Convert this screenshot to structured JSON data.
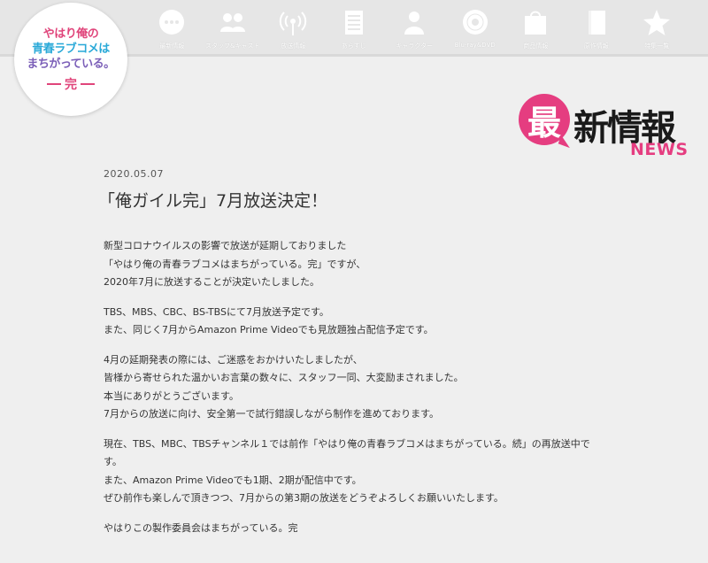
{
  "logo": {
    "lines": [
      "やはり俺の",
      "青春ラブコメは",
      "まちがっている。"
    ],
    "suffix": "完"
  },
  "nav": {
    "items": [
      {
        "label": "最新情報",
        "icon": "speech-bubble-icon"
      },
      {
        "label": "スタッフ&キャスト",
        "icon": "people-icon"
      },
      {
        "label": "放送情報",
        "icon": "broadcast-icon"
      },
      {
        "label": "あらすじ",
        "icon": "document-icon"
      },
      {
        "label": "キャラクター",
        "icon": "person-icon"
      },
      {
        "label": "Blu-ray&DVD",
        "icon": "disc-icon"
      },
      {
        "label": "商品情報",
        "icon": "shopping-bag-icon"
      },
      {
        "label": "原作情報",
        "icon": "book-icon"
      },
      {
        "label": "特集一覧",
        "icon": "star-icon"
      }
    ]
  },
  "heading": {
    "badge": "最",
    "title": "新情報",
    "sub": "NEWS"
  },
  "article": {
    "date": "2020.05.07",
    "title": "「俺ガイル完」7月放送決定！",
    "paragraphs": [
      [
        "新型コロナウイルスの影響で放送が延期しておりました",
        "「やはり俺の青春ラブコメはまちがっている。完」ですが、",
        "2020年7月に放送することが決定いたしました。"
      ],
      [
        "TBS、MBS、CBC、BS-TBSにて7月放送予定です。",
        "また、同じく7月からAmazon Prime Videoでも見放題独占配信予定です。"
      ],
      [
        "4月の延期発表の際には、ご迷惑をおかけいたしましたが、",
        "皆様から寄せられた温かいお言葉の数々に、スタッフ一同、大変励まされました。",
        "本当にありがとうございます。",
        "7月からの放送に向け、安全第一で試行錯誤しながら制作を進めております。"
      ],
      [
        "現在、TBS、MBC、TBSチャンネル１では前作「やはり俺の青春ラブコメはまちがっている。続」の再放送中で",
        "す。",
        "また、Amazon Prime Videoでも1期、2期が配信中です。",
        "ぜひ前作も楽しんで頂きつつ、7月からの第3期の放送をどうぞよろしくお願いいたします。"
      ],
      [
        "やはりこの製作委員会はまちがっている。完"
      ]
    ]
  },
  "colors": {
    "accent_pink": "#e53d80",
    "nav_bg": "#e6e6e6",
    "page_bg": "#efefef"
  }
}
